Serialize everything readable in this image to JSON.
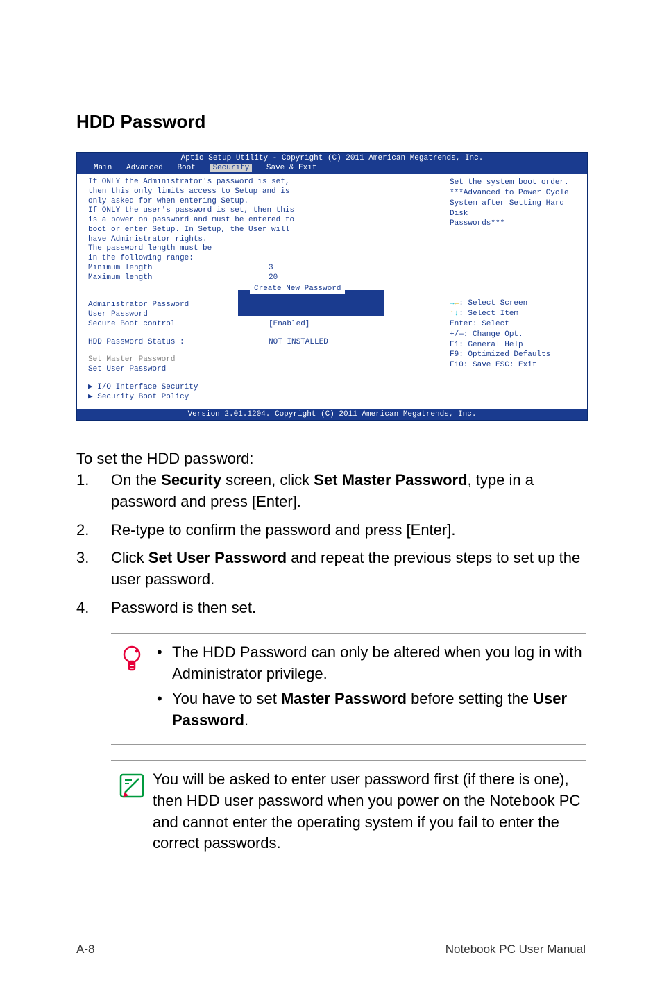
{
  "heading": "HDD Password",
  "bios": {
    "header": "Aptio Setup Utility - Copyright (C) 2011 American Megatrends, Inc.",
    "tabs": [
      "Main",
      "Advanced",
      "Boot",
      "Security",
      "Save & Exit"
    ],
    "active_tab": "Security",
    "left": {
      "intro": [
        "If ONLY the Administrator's password is set,",
        "then this only limits access to Setup and is",
        "only asked for when entering Setup.",
        "If ONLY the user's password is set, then this",
        "is a power on password and must be entered to",
        "boot or enter Setup. In Setup, the User will",
        "have Administrator rights.",
        "The password length must be",
        "in the following range:"
      ],
      "min_label": "Minimum length",
      "min_value": "3",
      "max_label": "Maximum length",
      "max_value": "20",
      "dialog_title": "Create New Password",
      "admin_pw": "Administrator Password",
      "user_pw": "User Password",
      "secure_boot_label": "Secure Boot control",
      "secure_boot_value": "[Enabled]",
      "hdd_status_label": "HDD Password Status :",
      "hdd_status_value": "NOT INSTALLED",
      "set_master": "Set Master Password",
      "set_user": "Set User Password",
      "io_sec": "I/O Interface Security",
      "boot_policy": "Security Boot Policy"
    },
    "right": {
      "help": [
        "Set the system boot order.",
        "***Advanced to Power Cycle",
        "System after Setting Hard Disk",
        "Passwords***"
      ],
      "nav": {
        "select_screen": "Select Screen",
        "select_item": "Select Item",
        "enter_select": "Enter: Select",
        "change_opt": "+/—:  Change Opt.",
        "f1": "F1:    General Help",
        "f9": "F9:    Optimized Defaults",
        "f10": "F10:  Save   ESC:  Exit"
      }
    },
    "footer": "Version 2.01.1204. Copyright (C) 2011 American Megatrends, Inc."
  },
  "intro_text": "To set the HDD password:",
  "steps": [
    {
      "n": "1.",
      "pre": "On the ",
      "b1": "Security",
      "mid": " screen, click ",
      "b2": "Set Master Password",
      "post": ", type in a password and press [Enter]."
    },
    {
      "n": "2.",
      "text": "Re-type to confirm the password and press [Enter]."
    },
    {
      "n": "3.",
      "pre": "Click ",
      "b1": "Set User Password",
      "post": " and repeat the previous steps to set up the user password."
    },
    {
      "n": "4.",
      "text": "Password is then set."
    }
  ],
  "callout1": {
    "b1": "The HDD Password can only be altered when you log in with Administrator privilege.",
    "b2_pre": "You have to set ",
    "b2_b1": "Master Password",
    "b2_mid": " before setting the ",
    "b2_b2": "User Password",
    "b2_post": "."
  },
  "callout2": "You will be asked to enter user password first (if there is one), then HDD user password when you power on the Notebook PC and cannot enter the operating system if you fail to enter the correct passwords.",
  "footer_left": "A-8",
  "footer_right": "Notebook PC User Manual"
}
